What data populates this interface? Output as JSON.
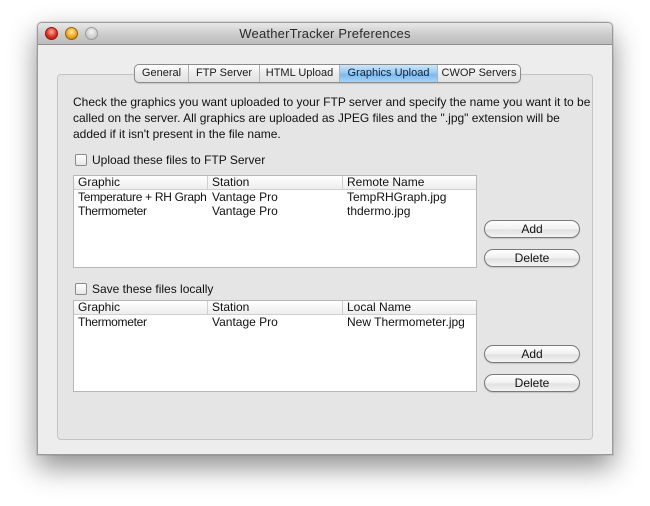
{
  "window": {
    "title": "WeatherTracker Preferences"
  },
  "tabs": [
    {
      "label": "General",
      "active": false
    },
    {
      "label": "FTP Server",
      "active": false
    },
    {
      "label": "HTML Upload",
      "active": false
    },
    {
      "label": "Graphics Upload",
      "active": true
    },
    {
      "label": "CWOP Servers",
      "active": false
    }
  ],
  "description": "Check the graphics you want uploaded to your FTP server and specify the name you want it to be called on the server. All graphics are uploaded as JPEG files and the \".jpg\" extension will be added if it isn't present in the file name.",
  "upload_section": {
    "checkbox_label": "Upload these files to FTP Server",
    "checked": false,
    "columns": [
      "Graphic",
      "Station",
      "Remote Name"
    ],
    "rows": [
      [
        "Temperature + RH Graph",
        "Vantage Pro",
        "TempRHGraph.jpg"
      ],
      [
        "Thermometer",
        "Vantage Pro",
        "thdermo.jpg"
      ]
    ],
    "add_label": "Add",
    "delete_label": "Delete"
  },
  "local_section": {
    "checkbox_label": "Save these files locally",
    "checked": false,
    "columns": [
      "Graphic",
      "Station",
      "Local Name"
    ],
    "rows": [
      [
        "Thermometer",
        "Vantage Pro",
        "New Thermometer.jpg"
      ]
    ],
    "add_label": "Add",
    "delete_label": "Delete"
  },
  "colors": {
    "active_tab": "#92c6f2",
    "window_bg": "#ededed",
    "panel_bg": "#e5e5e5"
  }
}
